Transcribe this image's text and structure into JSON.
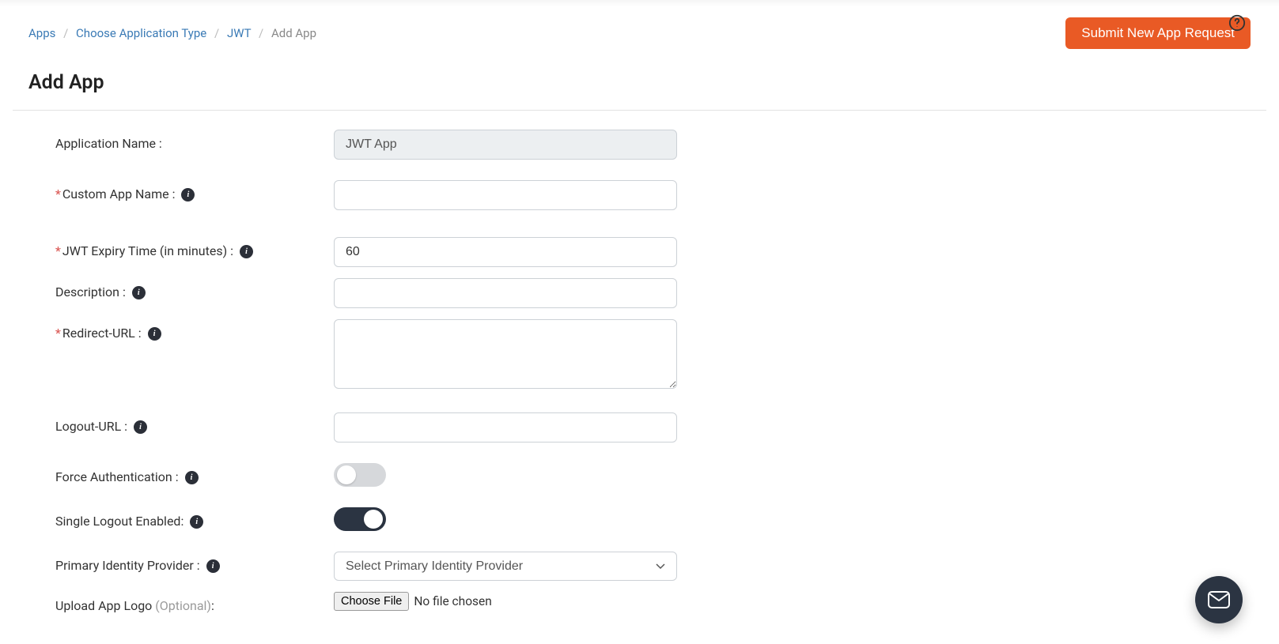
{
  "breadcrumb": {
    "items": [
      "Apps",
      "Choose Application Type",
      "JWT"
    ],
    "current": "Add App"
  },
  "header": {
    "submit_label": "Submit New App Request"
  },
  "page_title": "Add App",
  "form": {
    "app_name_label": "Application Name :",
    "app_name_value": "JWT App",
    "custom_name_label": "Custom App Name :",
    "custom_name_value": "",
    "jwt_expiry_label": "JWT Expiry Time (in minutes) :",
    "jwt_expiry_value": "60",
    "description_label": "Description :",
    "description_value": "",
    "redirect_label": "Redirect-URL :",
    "redirect_value": "",
    "logout_label": "Logout-URL :",
    "logout_value": "",
    "force_auth_label": "Force Authentication :",
    "single_logout_label": "Single Logout Enabled:",
    "primary_idp_label": "Primary Identity Provider :",
    "primary_idp_placeholder": "Select Primary Identity Provider",
    "upload_logo_label": "Upload App Logo ",
    "upload_logo_optional": "(Optional)",
    "upload_logo_colon": ":",
    "choose_file_label": "Choose File",
    "file_status": "No file chosen"
  },
  "toggles": {
    "force_auth": false,
    "single_logout": true
  }
}
